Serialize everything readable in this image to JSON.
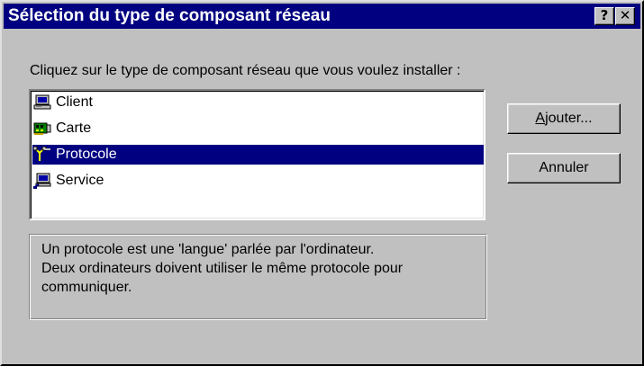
{
  "window": {
    "title": "Sélection du type de composant réseau",
    "help_label": "?",
    "close_label": "✕"
  },
  "prompt": "Cliquez sur le type de composant réseau que vous voulez installer :",
  "list": {
    "items": [
      {
        "label": "Client",
        "icon": "client-computer-icon",
        "selected": false
      },
      {
        "label": "Carte",
        "icon": "network-card-icon",
        "selected": false
      },
      {
        "label": "Protocole",
        "icon": "protocol-cable-icon",
        "selected": true
      },
      {
        "label": "Service",
        "icon": "service-computer-icon",
        "selected": false
      }
    ]
  },
  "buttons": {
    "add": {
      "mnemonic": "A",
      "rest": "jouter..."
    },
    "cancel": "Annuler"
  },
  "description": {
    "lines": [
      "Un protocole est une 'langue' parlée par l'ordinateur.",
      "Deux ordinateurs doivent utiliser le même protocole pour",
      "communiquer."
    ]
  },
  "colors": {
    "selection": "#000080",
    "face": "#c0c0c0",
    "titlebar": "#000080"
  }
}
